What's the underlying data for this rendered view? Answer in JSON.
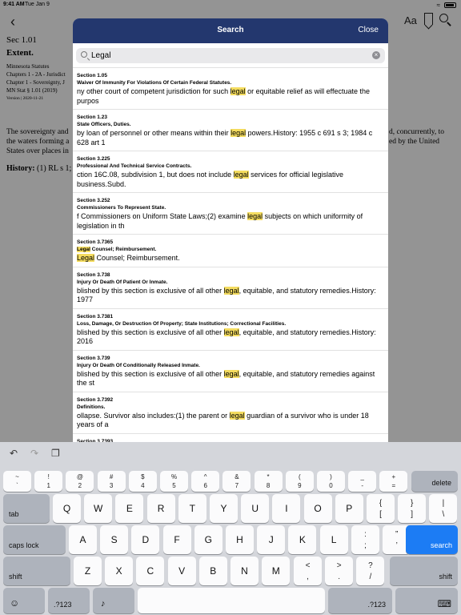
{
  "status_bar": {
    "time": "9:41 AM",
    "date": "Tue Jan 9"
  },
  "document": {
    "section": "Sec 1.01",
    "heading": "Extent.",
    "meta_lines": [
      "Minnesota Statutes",
      "Chapters 1 - 2A - Jurisdict",
      "Chapter 1 - Sovereignty, J",
      "MN Stat § 1.01 (2019)"
    ],
    "version": "Version | 2020-11-21",
    "para_left": [
      "The sovereignty and",
      "the waters forming a",
      "States over places in"
    ],
    "para_right": [
      "d, concurrently, to",
      "ed by the United"
    ],
    "history_label": "History:",
    "history_text": " (1) RL s 1;"
  },
  "modal": {
    "title": "Search",
    "close_label": "Close",
    "search": {
      "value": "Legal",
      "placeholder": "Search"
    },
    "results": [
      {
        "section": "Section 1.05",
        "title_parts": [
          {
            "t": "Waiver Of Immunity For Violations Of Certain Federal Statutes."
          }
        ],
        "snippet_parts": [
          {
            "t": "ny other court of competent jurisdiction for such "
          },
          {
            "t": "legal",
            "hl": true
          },
          {
            "t": " or equitable relief as will effectuate the purpos"
          }
        ]
      },
      {
        "section": "Section 1.23",
        "title_parts": [
          {
            "t": "State Officers, Duties."
          }
        ],
        "snippet_parts": [
          {
            "t": " by loan of personnel or other means within their "
          },
          {
            "t": "legal",
            "hl": true
          },
          {
            "t": " powers.History: 1955 c 691 s 3; 1984 c 628 art 1"
          }
        ]
      },
      {
        "section": "Section 3.225",
        "title_parts": [
          {
            "t": "Professional And Technical Service Contracts."
          }
        ],
        "snippet_parts": [
          {
            "t": "ction 16C.08, subdivision 1, but does not include "
          },
          {
            "t": "legal",
            "hl": true
          },
          {
            "t": " services for official legislative business.Subd."
          }
        ]
      },
      {
        "section": "Section 3.252",
        "title_parts": [
          {
            "t": "Commissioners To Represent State."
          }
        ],
        "snippet_parts": [
          {
            "t": "f Commissioners on Uniform State Laws;(2) examine "
          },
          {
            "t": "legal",
            "hl": true
          },
          {
            "t": " subjects on which uniformity of legislation in th"
          }
        ]
      },
      {
        "section": "Section 3.7365",
        "title_parts": [
          {
            "t": "Legal",
            "hl": true
          },
          {
            "t": " Counsel; Reimbursement."
          }
        ],
        "snippet_parts": [
          {
            "t": "Legal",
            "hl": true
          },
          {
            "t": " Counsel; Reimbursement."
          }
        ]
      },
      {
        "section": "Section 3.738",
        "title_parts": [
          {
            "t": "Injury Or Death Of Patient Or Inmate."
          }
        ],
        "snippet_parts": [
          {
            "t": "blished by this section is exclusive of all other "
          },
          {
            "t": "legal",
            "hl": true
          },
          {
            "t": ", equitable, and statutory remedies.History: 1977"
          }
        ]
      },
      {
        "section": "Section 3.7381",
        "title_parts": [
          {
            "t": "Loss, Damage, Or Destruction Of Property; State Institutions; Correctional Facilities."
          }
        ],
        "snippet_parts": [
          {
            "t": "blished by this section is exclusive of all other "
          },
          {
            "t": "legal",
            "hl": true
          },
          {
            "t": ", equitable, and statutory remedies.History:  2016"
          }
        ]
      },
      {
        "section": "Section 3.739",
        "title_parts": [
          {
            "t": "Injury Or Death Of Conditionally Released Inmate."
          }
        ],
        "snippet_parts": [
          {
            "t": "blished by this section is exclusive of all other "
          },
          {
            "t": "legal",
            "hl": true
          },
          {
            "t": ", equitable, and statutory remedies against the st"
          }
        ]
      },
      {
        "section": "Section 3.7392",
        "title_parts": [
          {
            "t": "Definitions."
          }
        ],
        "snippet_parts": [
          {
            "t": "ollapse. Survivor also includes:(1) the parent or "
          },
          {
            "t": "legal",
            "hl": true
          },
          {
            "t": " guardian of a survivor who is under 18 years of a"
          }
        ]
      },
      {
        "section": "Section 3.7393",
        "title_parts": [],
        "snippet_parts": []
      }
    ]
  },
  "keyboard": {
    "row1": [
      [
        "~",
        "`"
      ],
      [
        "!",
        "1"
      ],
      [
        "@",
        "2"
      ],
      [
        "#",
        "3"
      ],
      [
        "$",
        "4"
      ],
      [
        "%",
        "5"
      ],
      [
        "^",
        "6"
      ],
      [
        "&",
        "7"
      ],
      [
        "*",
        "8"
      ],
      [
        "(",
        "9"
      ],
      [
        ")",
        "0"
      ],
      [
        "_",
        "-"
      ],
      [
        "+",
        "="
      ]
    ],
    "delete_label": "delete",
    "tab_label": "tab",
    "row2": [
      "Q",
      "W",
      "E",
      "R",
      "T",
      "Y",
      "U",
      "I",
      "O",
      "P"
    ],
    "row2_extra": [
      [
        "{",
        "["
      ],
      [
        "}",
        "]"
      ],
      [
        "|",
        "\\"
      ]
    ],
    "caps_label": "caps lock",
    "row3": [
      "A",
      "S",
      "D",
      "F",
      "G",
      "H",
      "J",
      "K",
      "L"
    ],
    "row3_extra": [
      [
        ":",
        ";"
      ],
      [
        "”",
        "’"
      ]
    ],
    "search_label": "search",
    "shift_label": "shift",
    "row4": [
      "Z",
      "X",
      "C",
      "V",
      "B",
      "N",
      "M"
    ],
    "row4_extra": [
      [
        "<",
        ","
      ],
      [
        ">",
        "."
      ],
      [
        "?",
        "/"
      ]
    ],
    "numbers_label": ".?123"
  }
}
